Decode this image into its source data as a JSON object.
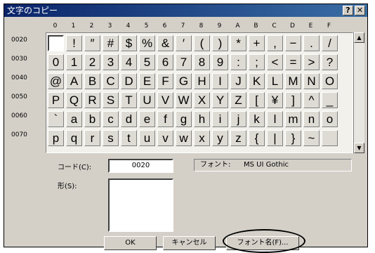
{
  "window": {
    "title": "文字のコピー",
    "help_glyph": "?",
    "close_glyph": "✕"
  },
  "columns": [
    "0",
    "1",
    "2",
    "3",
    "4",
    "5",
    "6",
    "7",
    "8",
    "9",
    "A",
    "B",
    "C",
    "D",
    "E",
    "F"
  ],
  "rows": [
    {
      "label": "0020",
      "chars": [
        "",
        "!",
        "″",
        "#",
        "$",
        "%",
        "&",
        "′",
        "(",
        ")",
        "*",
        "+",
        ",",
        "−",
        ".",
        "/"
      ]
    },
    {
      "label": "0030",
      "chars": [
        "0",
        "1",
        "2",
        "3",
        "4",
        "5",
        "6",
        "7",
        "8",
        "9",
        ":",
        ";",
        "<",
        "=",
        ">",
        "?"
      ]
    },
    {
      "label": "0040",
      "chars": [
        "@",
        "A",
        "B",
        "C",
        "D",
        "E",
        "F",
        "G",
        "H",
        "I",
        "J",
        "K",
        "L",
        "M",
        "N",
        "O"
      ]
    },
    {
      "label": "0050",
      "chars": [
        "P",
        "Q",
        "R",
        "S",
        "T",
        "U",
        "V",
        "W",
        "X",
        "Y",
        "Z",
        "[",
        "¥",
        "]",
        "^",
        "_"
      ]
    },
    {
      "label": "0060",
      "chars": [
        "`",
        "a",
        "b",
        "c",
        "d",
        "e",
        "f",
        "g",
        "h",
        "i",
        "j",
        "k",
        "l",
        "m",
        "n",
        "o"
      ]
    },
    {
      "label": "0070",
      "chars": [
        "p",
        "q",
        "r",
        "s",
        "t",
        "u",
        "v",
        "w",
        "x",
        "y",
        "z",
        "{",
        "|",
        "}",
        "~",
        ""
      ]
    }
  ],
  "code": {
    "label": "コード(C):",
    "value": "0020"
  },
  "font": {
    "label": "フォント:",
    "name": "MS UI Gothic"
  },
  "shape": {
    "label": "形(S):"
  },
  "buttons": {
    "ok": "OK",
    "cancel": "キャンセル",
    "font_name": "フォント名(F)..."
  },
  "scroll": {
    "up_glyph": "▲",
    "down_glyph": "▼"
  }
}
